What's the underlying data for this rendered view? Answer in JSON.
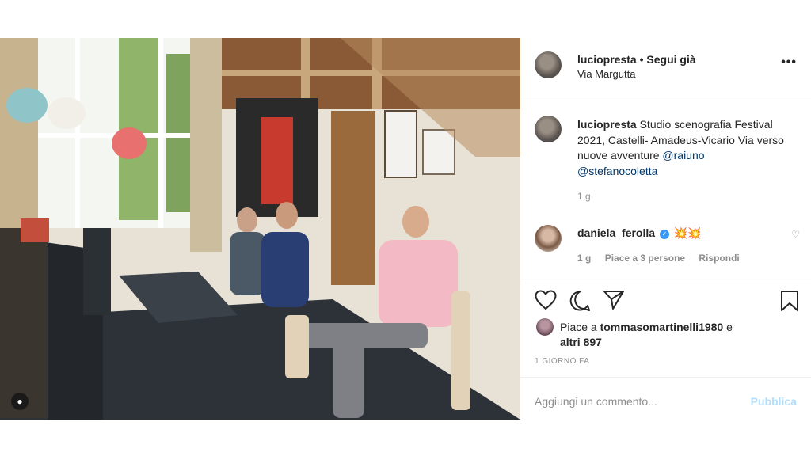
{
  "header": {
    "username": "luciopresta",
    "separator": " • ",
    "follow_status": "Segui già",
    "location": "Via Margutta",
    "more_icon": "more-horizontal-icon"
  },
  "caption": {
    "username": "luciopresta",
    "text": " Studio scenografia Festival 2021, Castelli- Amadeus-Vicario Via verso nuove avventure ",
    "mention_1": "@raiuno",
    "mention_2": "@stefanocoletta",
    "time": "1 g"
  },
  "comment": {
    "username": "daniela_ferolla",
    "emoji": "💥💥",
    "time": "1 g",
    "likes": "Piace a 3 persone",
    "reply": "Rispondi"
  },
  "likes": {
    "prefix": "Piace a ",
    "user": "tommasomartinelli1980",
    "middle": " e",
    "others": "altri 897"
  },
  "timestamp": "1 GIORNO FA",
  "add_comment": {
    "placeholder": "Aggiungi un commento...",
    "publish": "Pubblica"
  },
  "colors": {
    "link": "#00376b",
    "muted": "#8e8e8e",
    "publish_disabled": "#b2dffc",
    "verified": "#3897f0"
  }
}
